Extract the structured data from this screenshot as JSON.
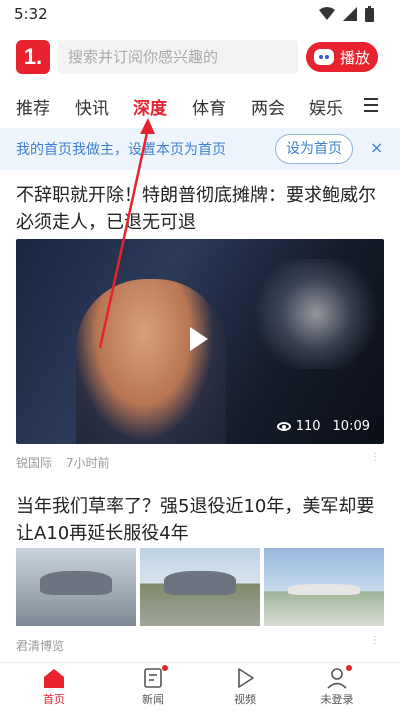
{
  "status_bar": {
    "time": "5:32"
  },
  "header": {
    "logo_text": "1.",
    "search_placeholder": "搜索并订阅你感兴趣的",
    "play_label": "播放"
  },
  "tabs": [
    "推荐",
    "快讯",
    "深度",
    "体育",
    "两会",
    "娱乐"
  ],
  "active_tab": "深度",
  "banner": {
    "text": "我的首页我做主，设置本页为首页",
    "button": "设为首页",
    "close": "×"
  },
  "article1": {
    "title": "不辞职就开除！特朗普彻底摊牌：要求鲍威尔必须走人，已退无可退",
    "views": "110",
    "duration": "10:09",
    "source": "锐国际",
    "time": "7小时前"
  },
  "article2": {
    "title": "当年我们草率了？强5退役近10年，美军却要让A10再延长服役4年",
    "source": "君清博览"
  },
  "bottom_nav": [
    {
      "label": "首页"
    },
    {
      "label": "新闻"
    },
    {
      "label": "视频"
    },
    {
      "label": "未登录"
    }
  ],
  "colors": {
    "brand": "#e8222f",
    "banner_text": "#3d7fcf"
  }
}
